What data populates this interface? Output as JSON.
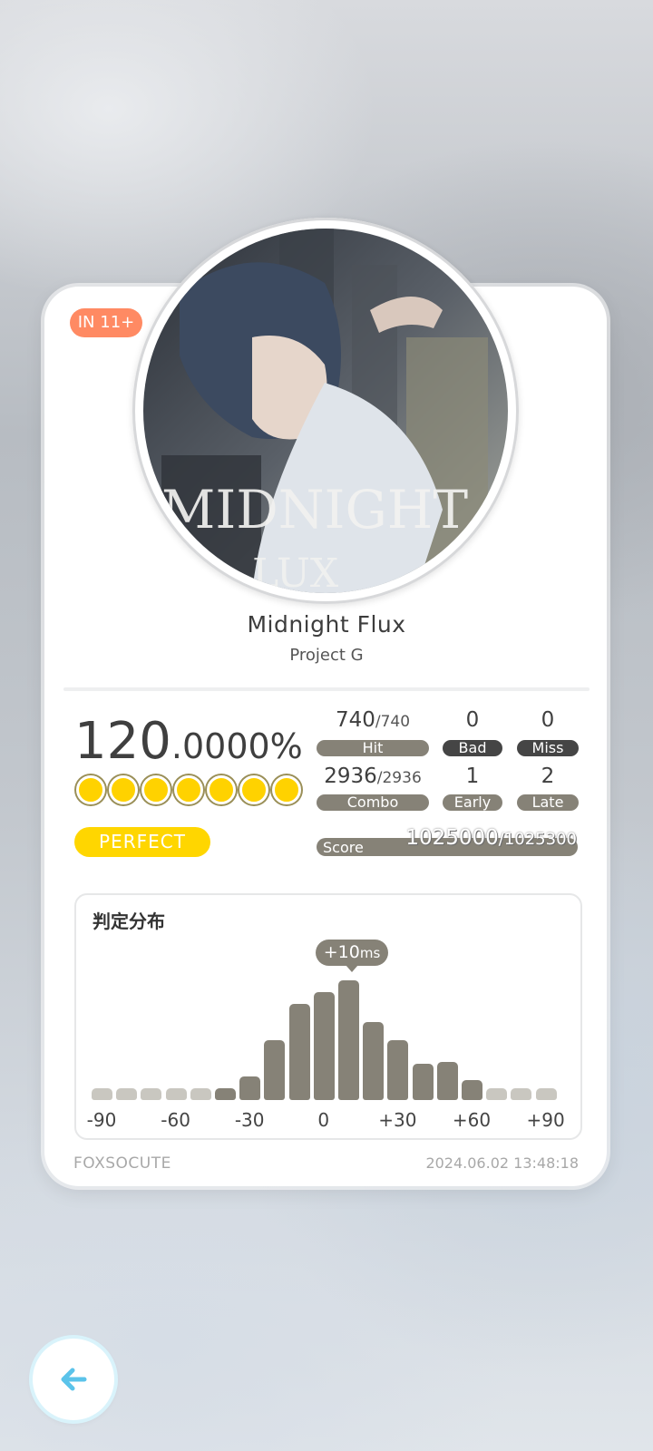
{
  "song": {
    "title": "Midnight Flux",
    "artist": "Project G",
    "level": "IN 11+",
    "cover_text": "MIDNIGHT",
    "cover_text_2": "LUX"
  },
  "result": {
    "accuracy_int": "120",
    "accuracy_dec": ".0000%",
    "grade": "PERFECT",
    "indicator_count": 7
  },
  "stats": {
    "hit_value": "740",
    "hit_total": "/740",
    "hit_label": "Hit",
    "bad_value": "0",
    "bad_label": "Bad",
    "miss_value": "0",
    "miss_label": "Miss",
    "combo_value": "2936",
    "combo_total": "/2936",
    "combo_label": "Combo",
    "early_value": "1",
    "early_label": "Early",
    "late_value": "2",
    "late_label": "Late",
    "score_label": "Score",
    "score_value": "1025000",
    "score_total": "/1025300"
  },
  "distribution": {
    "title": "判定分布",
    "offset_value": "+10",
    "offset_unit": "ms",
    "axis_labels": [
      "-90",
      "-60",
      "-30",
      "0",
      "+30",
      "+60",
      "+90"
    ]
  },
  "chart_data": {
    "type": "bar",
    "title": "判定分布",
    "x": [
      -90,
      -80,
      -70,
      -60,
      -50,
      -40,
      -30,
      -20,
      -10,
      0,
      10,
      20,
      30,
      40,
      50,
      60,
      70,
      80,
      90
    ],
    "values": [
      0.05,
      0.05,
      0.05,
      0.05,
      0.05,
      0.1,
      0.2,
      0.5,
      0.8,
      0.9,
      1.0,
      0.65,
      0.5,
      0.3,
      0.32,
      0.17,
      0.05,
      0.07,
      0.05
    ],
    "highlight_x": 10,
    "ylim": [
      0,
      1
    ],
    "grid": false,
    "colors": {
      "active": "#868277",
      "inactive": "#c9c7c0"
    }
  },
  "footer": {
    "player": "FOXSOCUTE",
    "timestamp": "2024.06.02 13:48:18"
  },
  "colors": {
    "level_badge": "#ff8a63",
    "grade": "#ffd600",
    "pill": "#868277",
    "pill_dark": "#454545",
    "back_arrow": "#5bc3ea"
  },
  "icons": {
    "back": "arrow-left-icon"
  }
}
